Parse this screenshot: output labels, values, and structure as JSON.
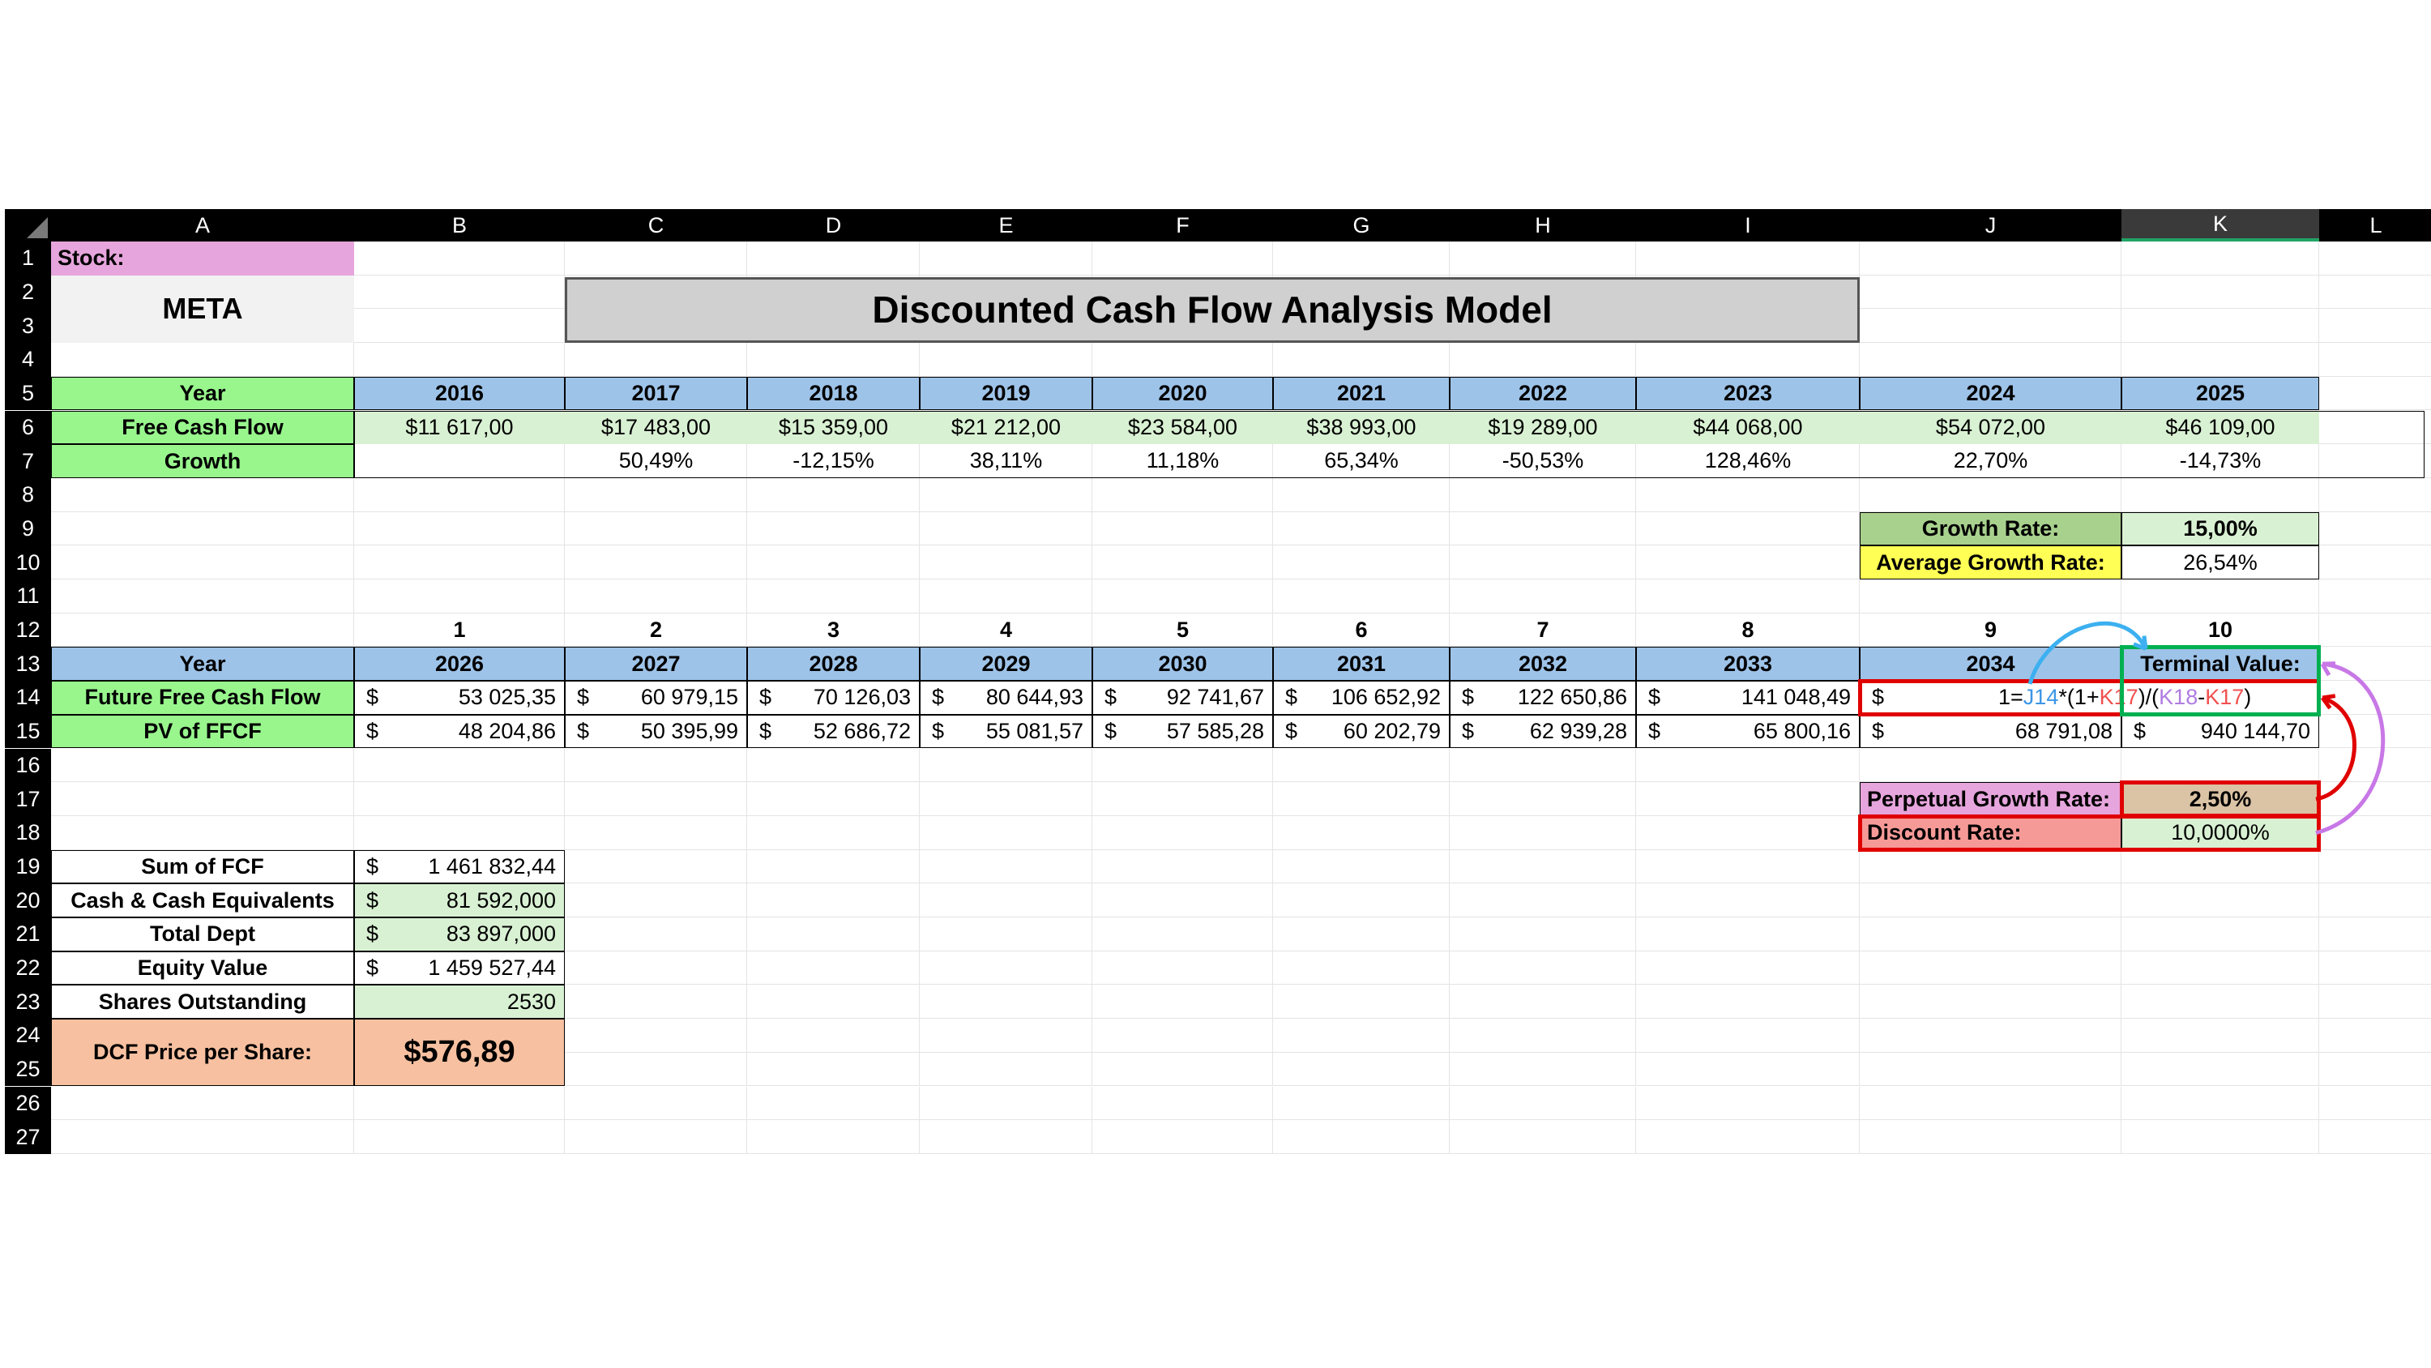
{
  "columns": [
    "A",
    "B",
    "C",
    "D",
    "E",
    "F",
    "G",
    "H",
    "I",
    "J",
    "K",
    "L"
  ],
  "rows": [
    "1",
    "2",
    "3",
    "4",
    "5",
    "6",
    "7",
    "8",
    "9",
    "10",
    "11",
    "12",
    "13",
    "14",
    "15",
    "16",
    "17",
    "18",
    "19",
    "20",
    "21",
    "22",
    "23",
    "24",
    "25",
    "26",
    "27"
  ],
  "stock_label": "Stock:",
  "ticker": "META",
  "title": "Discounted Cash Flow Analysis Model",
  "historical": {
    "year_label": "Year",
    "fcf_label": "Free Cash Flow",
    "growth_label": "Growth",
    "years": [
      "2016",
      "2017",
      "2018",
      "2019",
      "2020",
      "2021",
      "2022",
      "2023",
      "2024",
      "2025"
    ],
    "fcf": [
      "$11 617,00",
      "$17 483,00",
      "$15 359,00",
      "$21 212,00",
      "$23 584,00",
      "$38 993,00",
      "$19 289,00",
      "$44 068,00",
      "$54 072,00",
      "$46 109,00"
    ],
    "growth": [
      "",
      "50,49%",
      "-12,15%",
      "38,11%",
      "11,18%",
      "65,34%",
      "-50,53%",
      "128,46%",
      "22,70%",
      "-14,73%"
    ]
  },
  "rates": {
    "growth_rate_label": "Growth Rate:",
    "growth_rate": "15,00%",
    "avg_growth_label": "Average Growth Rate:",
    "avg_growth": "26,54%"
  },
  "projection": {
    "index": [
      "1",
      "2",
      "3",
      "4",
      "5",
      "6",
      "7",
      "8",
      "9",
      "10"
    ],
    "year_label": "Year",
    "years": [
      "2026",
      "2027",
      "2028",
      "2029",
      "2030",
      "2031",
      "2032",
      "2033",
      "2034"
    ],
    "terminal_label": "Terminal Value:",
    "ffcf_label": "Future Free Cash Flow",
    "pv_label": "PV of FFCF",
    "currency": "$",
    "ffcf": [
      "53 025,35",
      "60 979,15",
      "70 126,03",
      "80 644,93",
      "92 741,67",
      "106 652,92",
      "122 650,86",
      "141 048,49"
    ],
    "pv": [
      "48 204,86",
      "50 395,99",
      "52 686,72",
      "55 081,57",
      "57 585,28",
      "60 202,79",
      "62 939,28",
      "65 800,16",
      "68 791,08",
      "940 144,70"
    ]
  },
  "formula": {
    "prefix": "1=",
    "ref1": "J14",
    "part2": "*(1+",
    "ref2": "K17",
    "part3": ")/(",
    "ref3": "K18",
    "dash": "-",
    "ref4": "K17",
    "suffix": ")",
    "colors": {
      "ref1": "#3c96e6",
      "ref2": "#f05050",
      "ref3": "#b07ce0",
      "ref4": "#f05050"
    }
  },
  "terminal_inputs": {
    "perp_label": "Perpetual Growth Rate:",
    "perp": "2,50%",
    "disc_label": "Discount Rate:",
    "disc": "10,0000%"
  },
  "summary": {
    "sum_fcf_label": "Sum of FCF",
    "sum_fcf": "1 461 832,44",
    "cash_label": "Cash & Cash Equivalents",
    "cash": "81 592,000",
    "debt_label": "Total Dept",
    "debt": "83 897,000",
    "equity_label": "Equity Value",
    "equity": "1 459 527,44",
    "shares_label": "Shares Outstanding",
    "shares": "2530",
    "price_label": "DCF Price per Share:",
    "price": "$576,89"
  }
}
